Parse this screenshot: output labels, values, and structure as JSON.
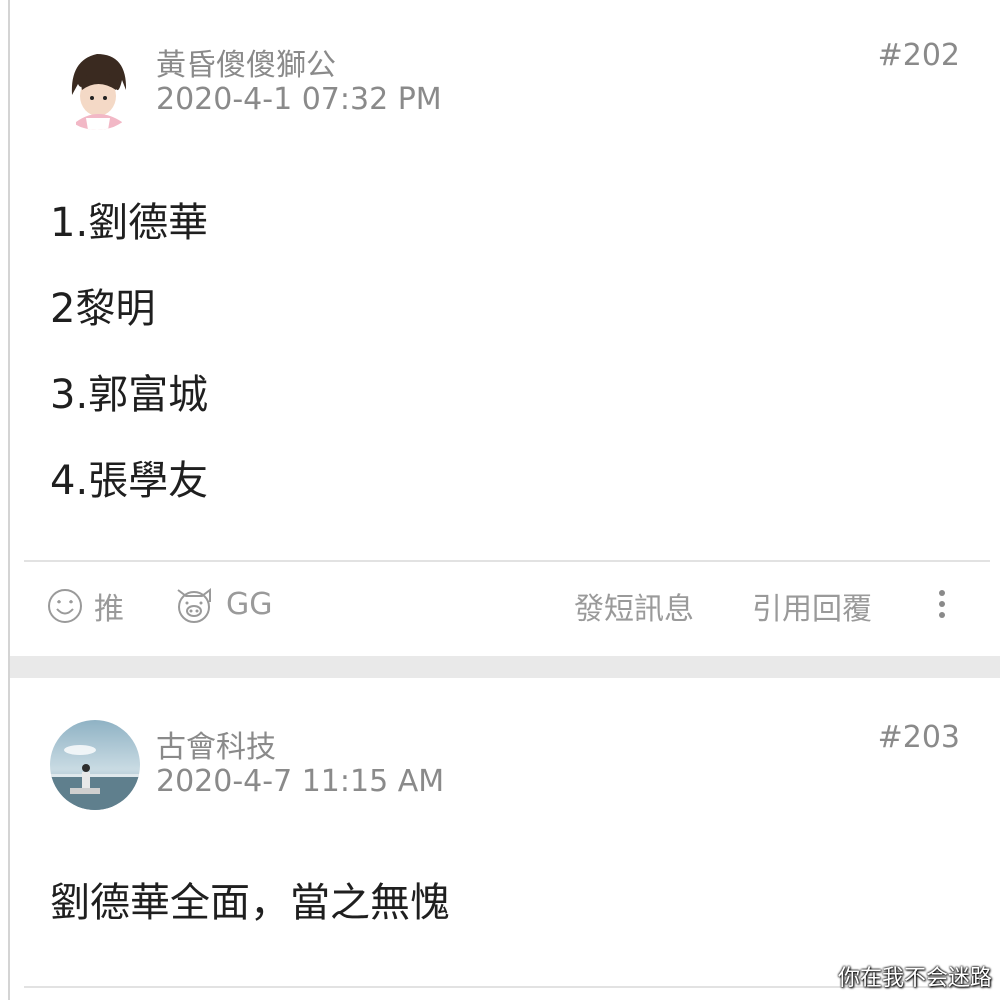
{
  "posts": [
    {
      "username": "黃昏傻傻獅公",
      "timestamp": "2020-4-1 07:32 PM",
      "floor": "#202",
      "content": [
        "1.劉德華",
        "2黎明",
        "3.郭富城",
        "4.張學友"
      ],
      "actions": {
        "push": "推",
        "gg": "GG",
        "message": "發短訊息",
        "quote": "引用回覆"
      }
    },
    {
      "username": "古會科技",
      "timestamp": "2020-4-7 11:15 AM",
      "floor": "#203",
      "content": [
        "劉德華全面，當之無愧"
      ]
    }
  ],
  "watermark": "你在我不会迷路",
  "colors": {
    "meta_text": "#8a8a8a",
    "body_text": "#1f1f1f",
    "action_text": "#9a9a9a",
    "divider": "#e2e2e2",
    "band": "#e9e9e9"
  }
}
